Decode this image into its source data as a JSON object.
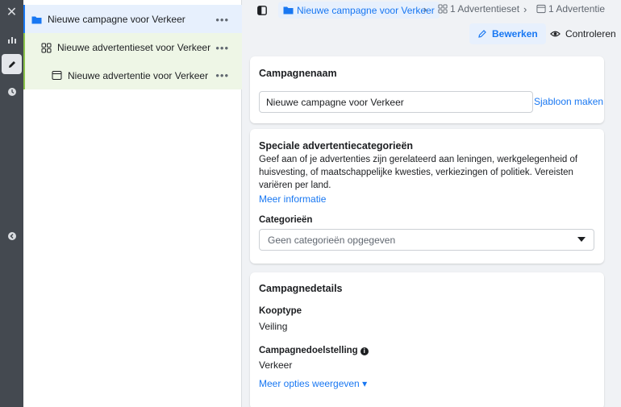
{
  "rail": {
    "close_glyph": "✕",
    "items": [
      {
        "icon": "bar-chart-icon"
      },
      {
        "icon": "pencil-icon"
      },
      {
        "icon": "clock-icon"
      },
      {
        "icon": "collapse-left-icon"
      }
    ]
  },
  "tree": {
    "campaign": {
      "label": "Nieuwe campagne voor Verkeer",
      "more": "•••"
    },
    "adset": {
      "label": "Nieuwe advertentieset voor Verkeer",
      "more": "•••"
    },
    "ad": {
      "label": "Nieuwe advertentie voor Verkeer",
      "more": "•••"
    }
  },
  "breadcrumb": {
    "campaign": "Nieuwe campagne voor Verkeer",
    "sep": "›",
    "adset": "1 Advertentieset",
    "ad": "1 Advertentie"
  },
  "actions": {
    "edit": "Bewerken",
    "review": "Controleren"
  },
  "campaign_name": {
    "title": "Campagnenaam",
    "value": "Nieuwe campagne voor Verkeer",
    "template_link": "Sjabloon maken"
  },
  "special_categories": {
    "title": "Speciale advertentiecategorieën",
    "description": "Geef aan of je advertenties zijn gerelateerd aan leningen, werkgelegenheid of huisvesting, of maatschappelijke kwesties, verkiezingen of politiek. Vereisten variëren per land.",
    "more_info": "Meer informatie",
    "categories_label": "Categorieën",
    "categories_placeholder": "Geen categorieën opgegeven"
  },
  "campaign_details": {
    "title": "Campagnedetails",
    "buying_type_label": "Kooptype",
    "buying_type_value": "Veiling",
    "objective_label": "Campagnedoelstelling",
    "objective_value": "Verkeer",
    "more_options": "Meer opties weergeven ▾"
  },
  "colors": {
    "accent": "#1877f2",
    "rail": "#444950",
    "campaign_row": "#e7f0fd",
    "adset_row": "#eef6e6"
  }
}
